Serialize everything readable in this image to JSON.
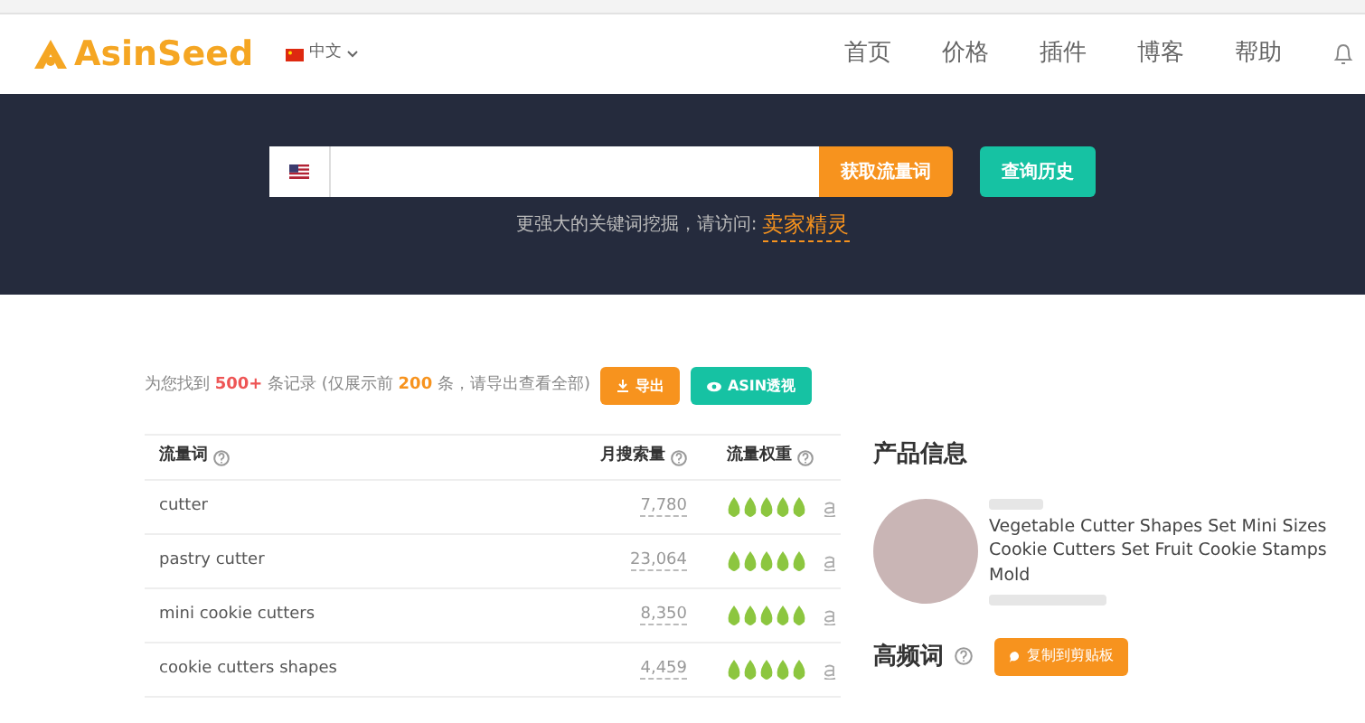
{
  "header": {
    "logo": "AsinSeed",
    "language": "中文",
    "nav": [
      {
        "label": "首页"
      },
      {
        "label": "价格"
      },
      {
        "label": "插件"
      },
      {
        "label": "博客"
      },
      {
        "label": "帮助"
      }
    ]
  },
  "search": {
    "button": "获取流量词",
    "history_button": "查询历史",
    "hint": "更强大的关键词挖掘，请访问:",
    "hint_link": "卖家精灵"
  },
  "results": {
    "summary": "为您找到 **500+** 条记录 (仅展示前 **200** 条，请导出查看全部)",
    "export_button": "导出",
    "asin_button": "ASIN透视"
  },
  "table": {
    "columns": [
      "流量词",
      "月搜索量",
      "流量权重"
    ],
    "rows": [
      {
        "keyword": "cutter",
        "volume": "7,780",
        "stars": 5
      },
      {
        "keyword": "pastry cutter",
        "volume": "23,064",
        "stars": 5
      },
      {
        "keyword": "mini cookie cutters",
        "volume": "8,350",
        "stars": 5
      },
      {
        "keyword": "cookie cutters shapes",
        "volume": "4,459",
        "stars": 5
      }
    ]
  },
  "product": {
    "heading": "产品信息",
    "title": "Vegetable Cutter Shapes Set Mini Sizes Cookie Cutters Set Fruit Cookie Stamps Mold"
  },
  "frequent": {
    "heading": "高频词",
    "copy_button": "复制到剪贴板"
  }
}
